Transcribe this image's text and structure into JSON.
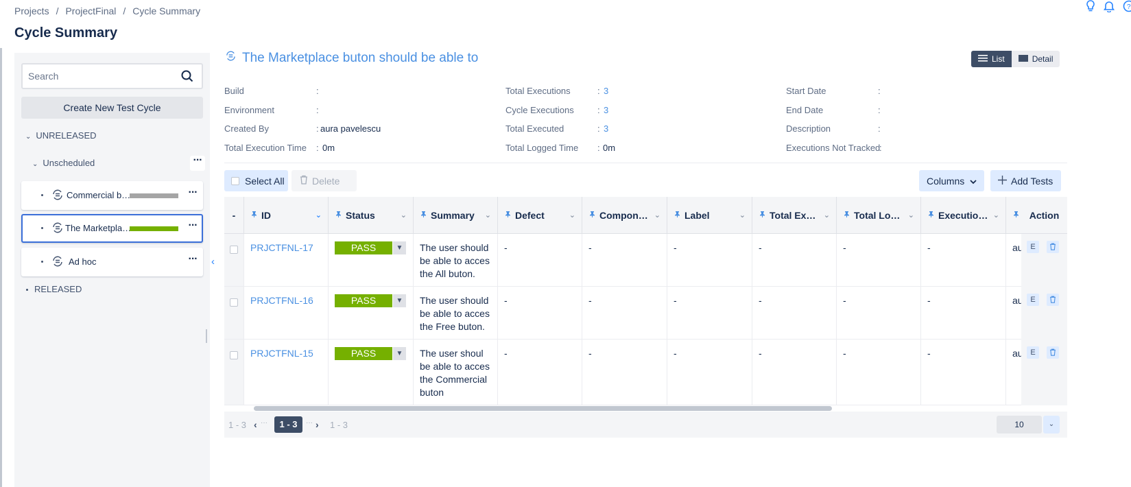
{
  "breadcrumb": [
    "Projects",
    "ProjectFinal",
    "Cycle Summary"
  ],
  "page_title": "Cycle Summary",
  "sidebar": {
    "search_placeholder": "Search",
    "create_label": "Create New Test Cycle",
    "unreleased_label": "UNRELEASED",
    "unscheduled_label": "Unscheduled",
    "released_label": "RELEASED",
    "cycles": [
      {
        "name": "Commercial b…",
        "progress_color": "#a5a5a5"
      },
      {
        "name": "The Marketpla…",
        "progress_color": "#75b000"
      },
      {
        "name": "Ad hoc"
      }
    ]
  },
  "cycle": {
    "title": "The Marketplace buton should be able to",
    "view_list": "List",
    "view_detail": "Detail",
    "info": {
      "build_label": "Build",
      "build_value": "",
      "environment_label": "Environment",
      "environment_value": "",
      "created_by_label": "Created By",
      "created_by_value": "aura pavelescu",
      "total_exec_time_label": "Total Execution Time",
      "total_exec_time_value": "0m",
      "total_executions_label": "Total Executions",
      "total_executions_value": "3",
      "cycle_executions_label": "Cycle Executions",
      "cycle_executions_value": "3",
      "total_executed_label": "Total Executed",
      "total_executed_value": "3",
      "total_logged_time_label": "Total Logged Time",
      "total_logged_time_value": "0m",
      "start_date_label": "Start Date",
      "start_date_value": "",
      "end_date_label": "End Date",
      "end_date_value": "",
      "description_label": "Description",
      "description_value": "",
      "not_tracked_label": "Executions Not Tracked",
      "not_tracked_value": ""
    }
  },
  "toolbar": {
    "select_all": "Select All",
    "delete": "Delete",
    "columns": "Columns",
    "add_tests": "Add Tests"
  },
  "table": {
    "first_header": "-",
    "headers": [
      "ID",
      "Status",
      "Summary",
      "Defect",
      "Compon…",
      "Label",
      "Total Ex…",
      "Total Lo…",
      "Executio…",
      ""
    ],
    "action_header": "Action",
    "rows": [
      {
        "id": "PRJCTFNL-17",
        "status": "PASS",
        "summary": "The user should be able to acces the All buton.",
        "defect": "-",
        "component": "-",
        "label": "-",
        "total_ex": "-",
        "total_lo": "-",
        "execution": "-",
        "executed_by": "au"
      },
      {
        "id": "PRJCTFNL-16",
        "status": "PASS",
        "summary": "The user should be able to acces the Free buton.",
        "defect": "-",
        "component": "-",
        "label": "-",
        "total_ex": "-",
        "total_lo": "-",
        "execution": "-",
        "executed_by": "au"
      },
      {
        "id": "PRJCTFNL-15",
        "status": "PASS",
        "summary": "The user shoul be able to acces the Commercial buton",
        "defect": "-",
        "component": "-",
        "label": "-",
        "total_ex": "-",
        "total_lo": "-",
        "execution": "-",
        "executed_by": "au"
      }
    ],
    "action_edit": "E",
    "status_color": "#75b000"
  },
  "pagination": {
    "range_left": "1 - 3",
    "current": "1 - 3",
    "range_right": "1 - 3",
    "page_size": "10"
  }
}
